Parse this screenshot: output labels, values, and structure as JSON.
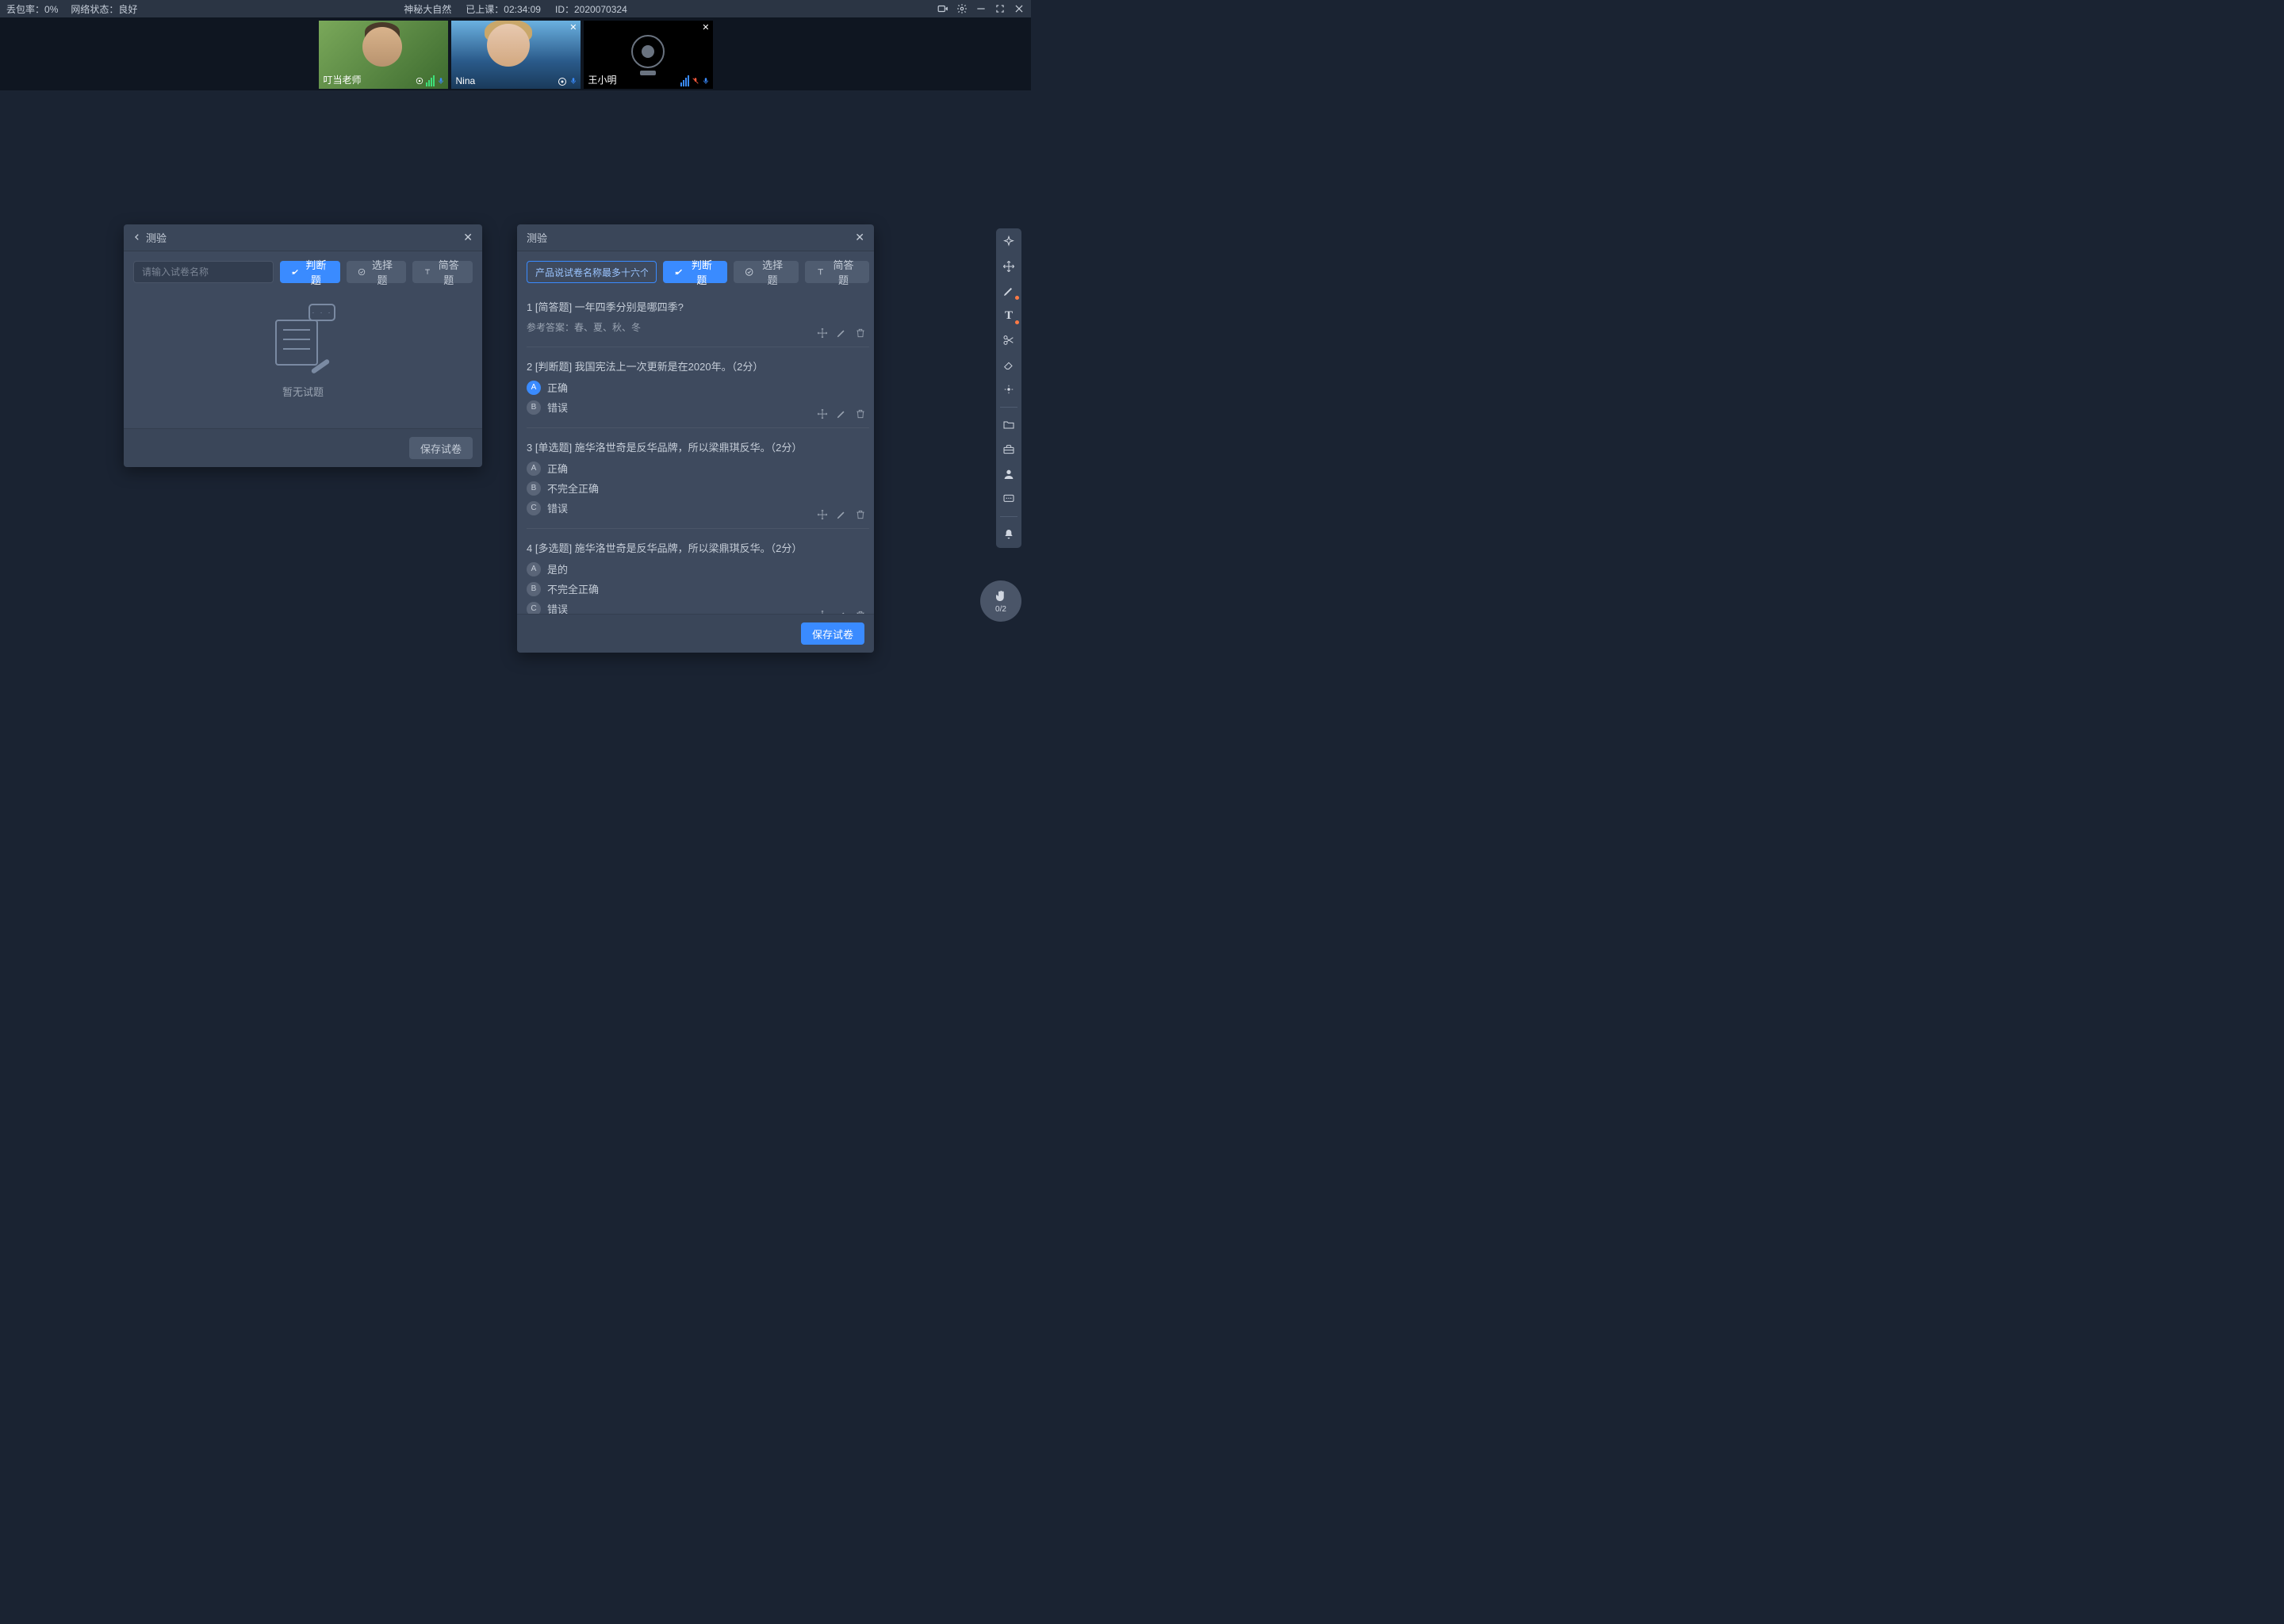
{
  "topbar": {
    "loss_label": "丢包率：",
    "loss_value": "0%",
    "net_label": "网络状态：",
    "net_value": "良好",
    "title": "神秘大自然",
    "duration_label": "已上课：",
    "duration_value": "02:34:09",
    "id_label": "ID：",
    "id_value": "2020070324"
  },
  "videos": [
    {
      "name": "叮当老师",
      "cam": true,
      "closable": false
    },
    {
      "name": "Nina",
      "cam": true,
      "closable": true
    },
    {
      "name": "王小明",
      "cam": false,
      "closable": true
    }
  ],
  "panelLeft": {
    "title": "测验",
    "placeholder": "请输入试卷名称",
    "btn_judge": "判断题",
    "btn_choice": "选择题",
    "btn_short": "简答题",
    "empty": "暂无试题",
    "save": "保存试卷"
  },
  "panelRight": {
    "title": "测验",
    "name_value": "产品说试卷名称最多十六个字",
    "btn_judge": "判断题",
    "btn_choice": "选择题",
    "btn_short": "简答题",
    "save": "保存试卷",
    "questions": [
      {
        "num": "1",
        "tag": "[简答题]",
        "text": "一年四季分别是哪四季?",
        "ref_label": "参考答案：",
        "ref": "春、夏、秋、冬",
        "opts": []
      },
      {
        "num": "2",
        "tag": "[判断题]",
        "text": "我国宪法上一次更新是在2020年。（2分）",
        "opts": [
          {
            "k": "A",
            "v": "正确",
            "sel": true
          },
          {
            "k": "B",
            "v": "错误",
            "sel": false
          }
        ]
      },
      {
        "num": "3",
        "tag": "[单选题]",
        "text": "施华洛世奇是反华品牌，所以梁鼎琪反华。（2分）",
        "opts": [
          {
            "k": "A",
            "v": "正确",
            "sel": false
          },
          {
            "k": "B",
            "v": "不完全正确",
            "sel": false
          },
          {
            "k": "C",
            "v": "错误",
            "sel": false
          }
        ]
      },
      {
        "num": "4",
        "tag": "[多选题]",
        "text": "施华洛世奇是反华品牌，所以梁鼎琪反华。（2分）",
        "opts": [
          {
            "k": "A",
            "v": "是的",
            "sel": false
          },
          {
            "k": "B",
            "v": "不完全正确",
            "sel": false
          },
          {
            "k": "C",
            "v": "错误",
            "sel": false
          }
        ]
      }
    ]
  },
  "hand": {
    "count": "0/2"
  }
}
